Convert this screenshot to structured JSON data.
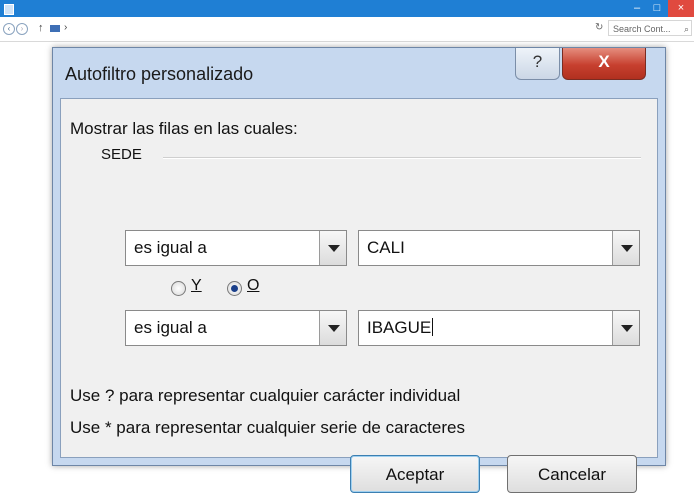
{
  "window": {
    "minimize": "–",
    "maximize": "□",
    "close": "×"
  },
  "addressbar": {
    "back": "‹",
    "forward": "›",
    "up": "↑",
    "chevron": "›",
    "refresh": "↻",
    "search_placeholder": "Search Cont...",
    "search_icon": "⌕"
  },
  "dialog": {
    "title": "Autofiltro personalizado",
    "help_label": "?",
    "close_label": "X",
    "show_rows_label": "Mostrar las filas en las cuales:",
    "field_name": "SEDE",
    "condition1": {
      "operator": "es igual a",
      "value": "CALI"
    },
    "logic": {
      "and_label": "Y",
      "or_label": "O",
      "selected": "O"
    },
    "condition2": {
      "operator": "es igual a",
      "value": "IBAGUE"
    },
    "hint_single": "Use ? para representar cualquier carácter individual",
    "hint_series": "Use * para representar cualquier serie de caracteres",
    "ok_label": "Aceptar",
    "cancel_label": "Cancelar"
  },
  "colors": {
    "titlebar": "#1f7fd4",
    "dialog_frame": "#c6d8ef",
    "close_button": "#c7402f"
  }
}
